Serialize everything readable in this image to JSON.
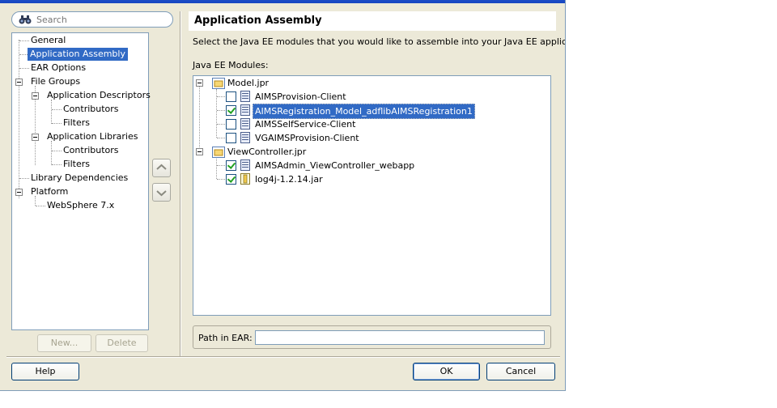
{
  "search": {
    "placeholder": "Search"
  },
  "nav": {
    "items": [
      {
        "label": "General"
      },
      {
        "label": "Application Assembly"
      },
      {
        "label": "EAR Options"
      },
      {
        "label": "File Groups"
      },
      {
        "label": "Application Descriptors"
      },
      {
        "label": "Contributors"
      },
      {
        "label": "Filters"
      },
      {
        "label": "Application Libraries"
      },
      {
        "label": "Contributors"
      },
      {
        "label": "Filters"
      },
      {
        "label": "Library Dependencies"
      },
      {
        "label": "Platform"
      },
      {
        "label": "WebSphere 7.x"
      }
    ],
    "new_label": "New...",
    "delete_label": "Delete"
  },
  "panel": {
    "title": "Application Assembly",
    "description": "Select the Java EE modules that you would like to assemble into your Java EE application.",
    "modules_label_first": "J",
    "modules_label_rest": "ava EE Modules:",
    "projects": [
      {
        "name": "Model.jpr",
        "modules": [
          {
            "name": "AIMSProvision-Client",
            "checked": false
          },
          {
            "name": "AIMSRegistration_Model_adflibAIMSRegistration1",
            "checked": true,
            "selected": true
          },
          {
            "name": "AIMSSelfService-Client",
            "checked": false
          },
          {
            "name": "VGAIMSProvision-Client",
            "checked": false
          }
        ]
      },
      {
        "name": "ViewController.jpr",
        "modules": [
          {
            "name": "AIMSAdmin_ViewController_webapp",
            "checked": true
          },
          {
            "name": "log4j-1.2.14.jar",
            "checked": true
          }
        ]
      }
    ],
    "path_label": "Path in EAR:",
    "path_value": ""
  },
  "footer": {
    "help_label": "Help",
    "ok_label": "OK",
    "cancel_label": "Cancel"
  },
  "colors": {
    "selection": "#316ac5",
    "dialog_bg": "#ece9d8",
    "border": "#7f9db9"
  }
}
